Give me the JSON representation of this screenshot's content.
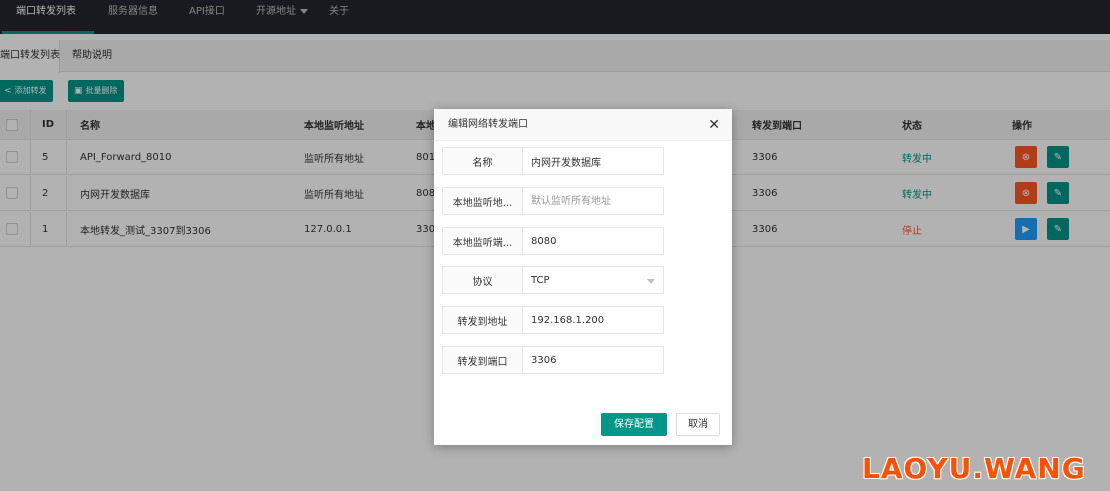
{
  "nav": {
    "items": [
      "端口转发列表",
      "服务器信息",
      "API接口",
      "开源地址",
      "关于"
    ],
    "accent": "#009688"
  },
  "subtabs": [
    "端口转发列表",
    "帮助说明"
  ],
  "toolbar": {
    "add_label": "添加转发",
    "batch_delete_label": "批量删除"
  },
  "table": {
    "columns": [
      "ID",
      "名称",
      "本地监听地址",
      "本地监听端口",
      "转发到端口",
      "状态",
      "操作"
    ],
    "rows": [
      {
        "id": "5",
        "name": "API_Forward_8010",
        "listen_addr": "监听所有地址",
        "listen_port": "8010",
        "target_port": "3306",
        "status": "转发中"
      },
      {
        "id": "2",
        "name": "内网开发数据库",
        "listen_addr": "监听所有地址",
        "listen_port": "8080",
        "target_port": "3306",
        "status": "转发中"
      },
      {
        "id": "1",
        "name": "本地转发_测试_3307到3306",
        "listen_addr": "127.0.0.1",
        "listen_port": "3307",
        "target_port": "3306",
        "status": "停止"
      }
    ],
    "status_on_color": "#009688",
    "status_off_color": "#ff5722"
  },
  "modal": {
    "title": "编辑网络转发端口",
    "fields": [
      {
        "label": "名称",
        "value": "内网开发数据库",
        "placeholder": ""
      },
      {
        "label": "本地监听地...",
        "value": "",
        "placeholder": "默认监听所有地址"
      },
      {
        "label": "本地监听端...",
        "value": "8080",
        "placeholder": ""
      },
      {
        "label": "协议",
        "value": "TCP",
        "placeholder": ""
      },
      {
        "label": "转发到地址",
        "value": "192.168.1.200",
        "placeholder": ""
      },
      {
        "label": "转发到端口",
        "value": "3306",
        "placeholder": ""
      }
    ],
    "save_label": "保存配置",
    "cancel_label": "取消"
  },
  "watermark": "LAOYU.WANG"
}
